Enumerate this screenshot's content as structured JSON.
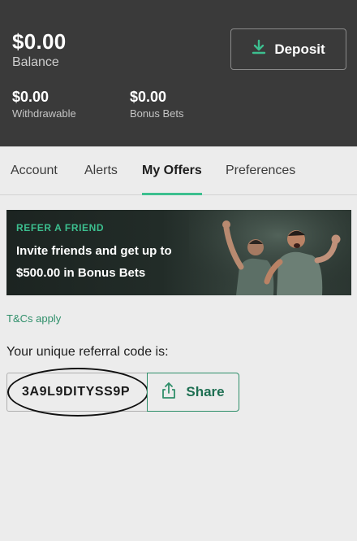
{
  "header": {
    "balance": "$0.00",
    "balance_label": "Balance",
    "deposit_label": "Deposit",
    "withdrawable": {
      "amount": "$0.00",
      "label": "Withdrawable"
    },
    "bonus_bets": {
      "amount": "$0.00",
      "label": "Bonus Bets"
    }
  },
  "tabs": [
    {
      "label": "Account",
      "active": false
    },
    {
      "label": "Alerts",
      "active": false
    },
    {
      "label": "My Offers",
      "active": true
    },
    {
      "label": "Preferences",
      "active": false
    }
  ],
  "banner": {
    "eyebrow": "REFER A FRIEND",
    "line1": "Invite friends and get up to",
    "line2": "$500.00 in Bonus Bets"
  },
  "tcs": "T&Cs apply",
  "referral": {
    "title": "Your unique referral code is:",
    "code": "3A9L9DITYSS9P",
    "share_label": "Share"
  },
  "colors": {
    "accent": "#3cbf8f",
    "header_bg": "#3a3a3a",
    "link": "#2f8f6a"
  },
  "icons": [
    "download-icon",
    "share-icon"
  ]
}
